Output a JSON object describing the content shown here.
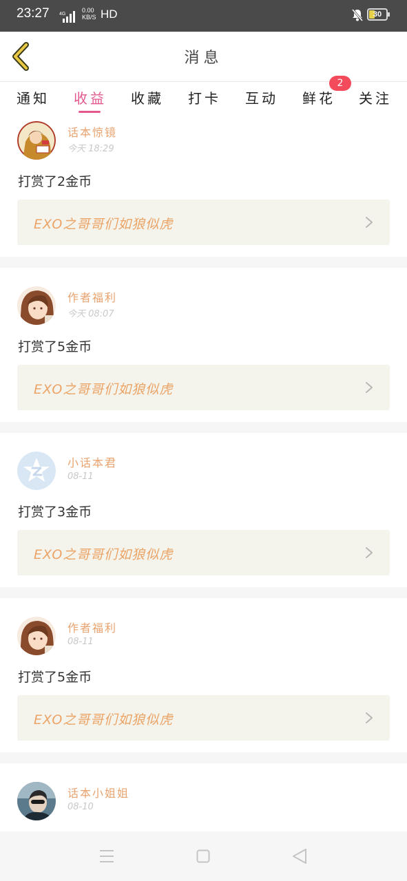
{
  "status": {
    "time": "23:27",
    "net_gen": "4G",
    "speed_value": "0.00",
    "speed_unit": "KB/S",
    "hd": "HD",
    "battery": "30",
    "battery_level": 0.3
  },
  "header": {
    "title": "消息"
  },
  "tabs": [
    {
      "label": "通知"
    },
    {
      "label": "收益"
    },
    {
      "label": "收藏"
    },
    {
      "label": "打卡"
    },
    {
      "label": "互动"
    },
    {
      "label": "鲜花",
      "badge": "2"
    },
    {
      "label": "关注"
    }
  ],
  "messages": [
    {
      "author": "话本惊镜",
      "time": "今天 18:29",
      "text": "打赏了2金币",
      "book": "EXO之哥哥们如狼似虎"
    },
    {
      "author": "作者福利",
      "time": "今天 08:07",
      "text": "打赏了5金币",
      "book": "EXO之哥哥们如狼似虎"
    },
    {
      "author": "小话本君",
      "time": "08-11",
      "text": "打赏了3金币",
      "book": "EXO之哥哥们如狼似虎"
    },
    {
      "author": "作者福利",
      "time": "08-11",
      "text": "打赏了5金币",
      "book": "EXO之哥哥们如狼似虎"
    },
    {
      "author": "话本小姐姐",
      "time": "08-10"
    }
  ],
  "colors": {
    "accent": "#e3568e",
    "author": "#e8a36f",
    "book_title": "#eba366",
    "badge": "#f34b5c",
    "status_bar": "#4a4a4a"
  }
}
